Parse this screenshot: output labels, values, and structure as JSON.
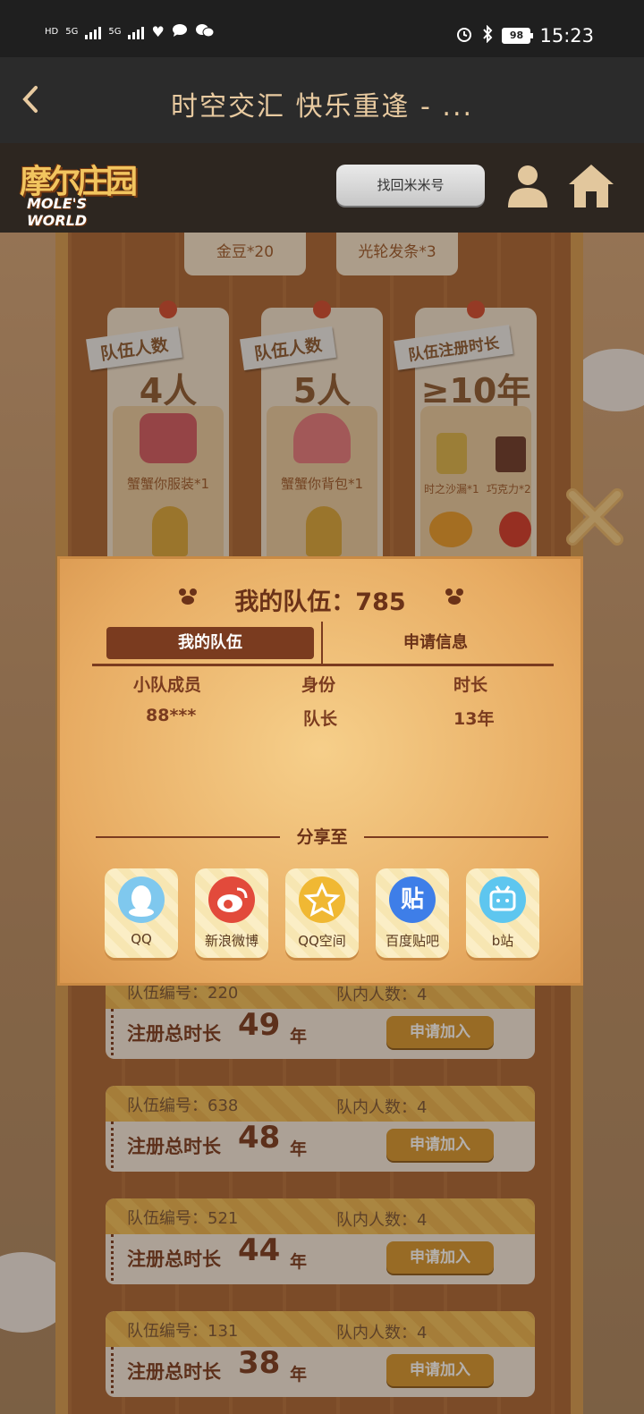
{
  "status_bar": {
    "time": "15:23",
    "battery": "98",
    "net1": "5G",
    "net2": "5G",
    "hd": "HD"
  },
  "title_bar": {
    "title": "时空交汇 快乐重逢 - ..."
  },
  "header": {
    "logo_main": "摩尔庄园",
    "logo_sub": "MOLE'S WORLD",
    "retrieve_label": "找回米米号"
  },
  "top_rewards": [
    {
      "label": "金豆*20"
    },
    {
      "label": "光轮发条*3"
    }
  ],
  "cards": [
    {
      "tag": "队伍人数",
      "value": "4人",
      "item": "蟹蟹你服装*1"
    },
    {
      "tag": "队伍人数",
      "value": "5人",
      "item": "蟹蟹你背包*1"
    },
    {
      "tag": "队伍注册时长",
      "value": "≥10年",
      "items": [
        "时之沙漏*1",
        "巧克力*2"
      ]
    }
  ],
  "modal": {
    "title": "我的队伍：785",
    "tabs": [
      "我的队伍",
      "申请信息"
    ],
    "columns": [
      "小队成员",
      "身份",
      "时长"
    ],
    "rows": [
      {
        "member": "88***",
        "role": "队长",
        "duration": "13年"
      }
    ],
    "share_label": "分享至",
    "share_targets": [
      {
        "label": "QQ",
        "color": "#7fc8ee",
        "icon": "qq-icon",
        "glyph": ""
      },
      {
        "label": "新浪微博",
        "color": "#e24a3b",
        "icon": "weibo-icon",
        "glyph": ""
      },
      {
        "label": "QQ空间",
        "color": "#f0b833",
        "icon": "qzone-icon",
        "glyph": ""
      },
      {
        "label": "百度贴吧",
        "color": "#3e7ee8",
        "icon": "tieba-icon",
        "glyph": "贴"
      },
      {
        "label": "b站",
        "color": "#5ec6ef",
        "icon": "bilibili-icon",
        "glyph": ""
      }
    ]
  },
  "team_list": [
    {
      "id_label": "队伍编号：220",
      "count_label": "队内人数：4",
      "len_label": "注册总时长",
      "len": "49",
      "unit": "年",
      "join": "申请加入"
    },
    {
      "id_label": "队伍编号：638",
      "count_label": "队内人数：4",
      "len_label": "注册总时长",
      "len": "48",
      "unit": "年",
      "join": "申请加入"
    },
    {
      "id_label": "队伍编号：521",
      "count_label": "队内人数：4",
      "len_label": "注册总时长",
      "len": "44",
      "unit": "年",
      "join": "申请加入"
    },
    {
      "id_label": "队伍编号：131",
      "count_label": "队内人数：4",
      "len_label": "注册总时长",
      "len": "38",
      "unit": "年",
      "join": "申请加入"
    }
  ]
}
